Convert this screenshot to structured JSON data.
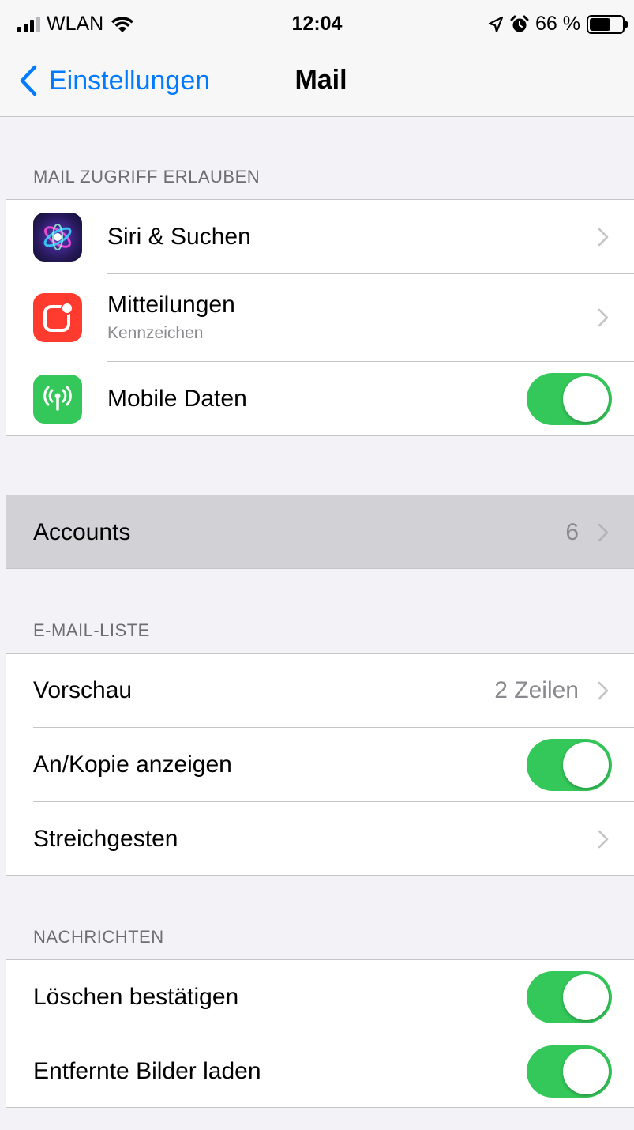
{
  "status_bar": {
    "carrier": "WLAN",
    "time": "12:04",
    "battery_percent_label": "66 %",
    "battery_level": 0.66
  },
  "nav": {
    "back_label": "Einstellungen",
    "title": "Mail"
  },
  "sections": {
    "access": {
      "header": "MAIL ZUGRIFF ERLAUBEN",
      "siri": {
        "label": "Siri & Suchen",
        "icon": "siri-icon"
      },
      "notifications": {
        "label": "Mitteilungen",
        "sublabel": "Kennzeichen",
        "icon": "notifications-icon"
      },
      "mobile_data": {
        "label": "Mobile Daten",
        "icon": "cellular-icon",
        "enabled": true
      }
    },
    "accounts": {
      "label": "Accounts",
      "count": "6"
    },
    "mail_list": {
      "header": "E-MAIL-LISTE",
      "preview": {
        "label": "Vorschau",
        "value": "2 Zeilen"
      },
      "show_to_cc": {
        "label": "An/Kopie anzeigen",
        "enabled": true
      },
      "swipe": {
        "label": "Streichgesten"
      }
    },
    "messages": {
      "header": "NACHRICHTEN",
      "ask_delete": {
        "label": "Löschen bestätigen",
        "enabled": true
      },
      "load_remote": {
        "label": "Entfernte Bilder laden",
        "enabled": true
      }
    }
  },
  "colors": {
    "accent": "#007aff",
    "toggle_on": "#34c759",
    "notifications_icon_bg": "#ff3b30",
    "cellular_icon_bg": "#34c759",
    "background": "#f2f2f7"
  }
}
